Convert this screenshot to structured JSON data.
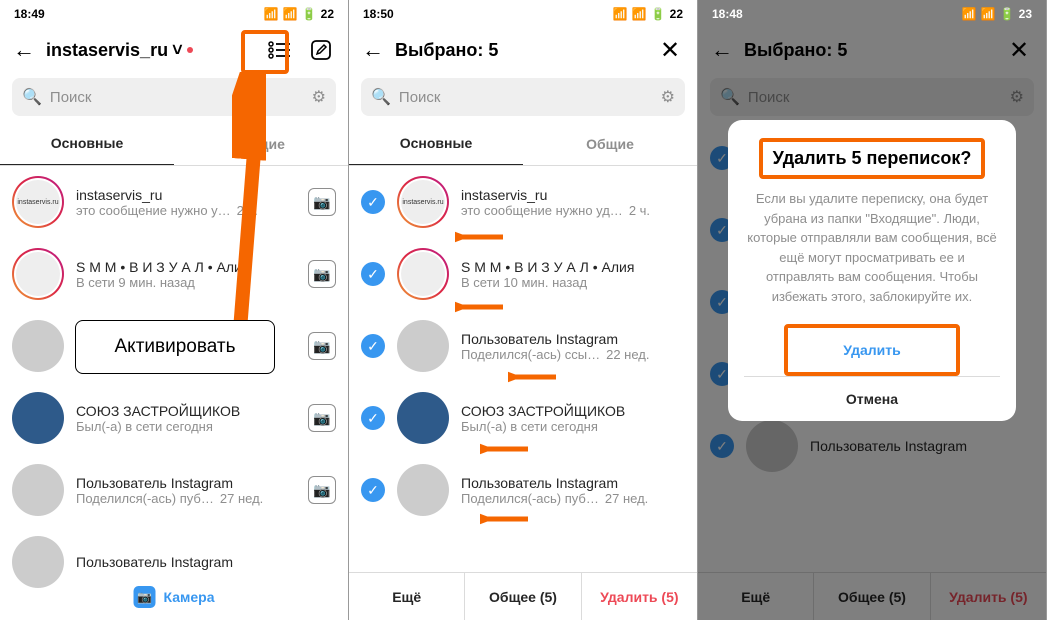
{
  "screen1": {
    "time": "18:49",
    "battery": "22",
    "title": "instaservis_ru",
    "search_placeholder": "Поиск",
    "tabs": {
      "primary": "Основные",
      "general": "Общие"
    },
    "chats": [
      {
        "name": "instaservis_ru",
        "sub": "это сообщение нужно у…",
        "time": "2 ч."
      },
      {
        "name": "S M M • В И З У А Л • Алия",
        "sub": "В сети 9 мин. назад",
        "time": ""
      },
      {
        "name": "",
        "sub": "",
        "time": ""
      },
      {
        "name": "СОЮЗ ЗАСТРОЙЩИКОВ",
        "sub": "Был(-а) в сети сегодня",
        "time": ""
      },
      {
        "name": "Пользователь Instagram",
        "sub": "Поделился(-ась) пуб…",
        "time": "27 нед."
      },
      {
        "name": "Пользователь Instagram",
        "sub": "",
        "time": ""
      }
    ],
    "camera": "Камера",
    "callout": "Активировать"
  },
  "screen2": {
    "time": "18:50",
    "battery": "22",
    "title": "Выбрано: 5",
    "search_placeholder": "Поиск",
    "tabs": {
      "primary": "Основные",
      "general": "Общие"
    },
    "chats": [
      {
        "name": "instaservis_ru",
        "sub": "это сообщение нужно уд…",
        "time": "2 ч."
      },
      {
        "name": "S M M • В И З У А Л • Алия",
        "sub": "В сети 10 мин. назад",
        "time": ""
      },
      {
        "name": "Пользователь Instagram",
        "sub": "Поделился(-ась) ссы…",
        "time": "22 нед."
      },
      {
        "name": "СОЮЗ ЗАСТРОЙЩИКОВ",
        "sub": "Был(-а) в сети сегодня",
        "time": ""
      },
      {
        "name": "Пользователь Instagram",
        "sub": "Поделился(-ась) пуб…",
        "time": "27 нед."
      }
    ],
    "actions": {
      "more": "Ещё",
      "general": "Общее (5)",
      "delete": "Удалить (5)"
    }
  },
  "screen3": {
    "time": "18:48",
    "battery": "23",
    "title": "Выбрано: 5",
    "search_placeholder": "Поиск",
    "chats": [
      {
        "name": "",
        "sub": ""
      },
      {
        "name": "",
        "sub": ""
      },
      {
        "name": "",
        "sub": ""
      },
      {
        "name": "",
        "sub": ""
      },
      {
        "name": "Пользователь Instagram",
        "sub": ""
      }
    ],
    "modal": {
      "title": "Удалить 5 переписок?",
      "text": "Если вы удалите переписку, она будет убрана из папки \"Входящие\". Люди, которые отправляли вам сообщения, всё ещё могут просматривать ее и отправлять вам сообщения. Чтобы избежать этого, заблокируйте их.",
      "delete": "Удалить",
      "cancel": "Отмена"
    },
    "actions": {
      "more": "Ещё",
      "general": "Общее (5)",
      "delete": "Удалить (5)"
    }
  }
}
